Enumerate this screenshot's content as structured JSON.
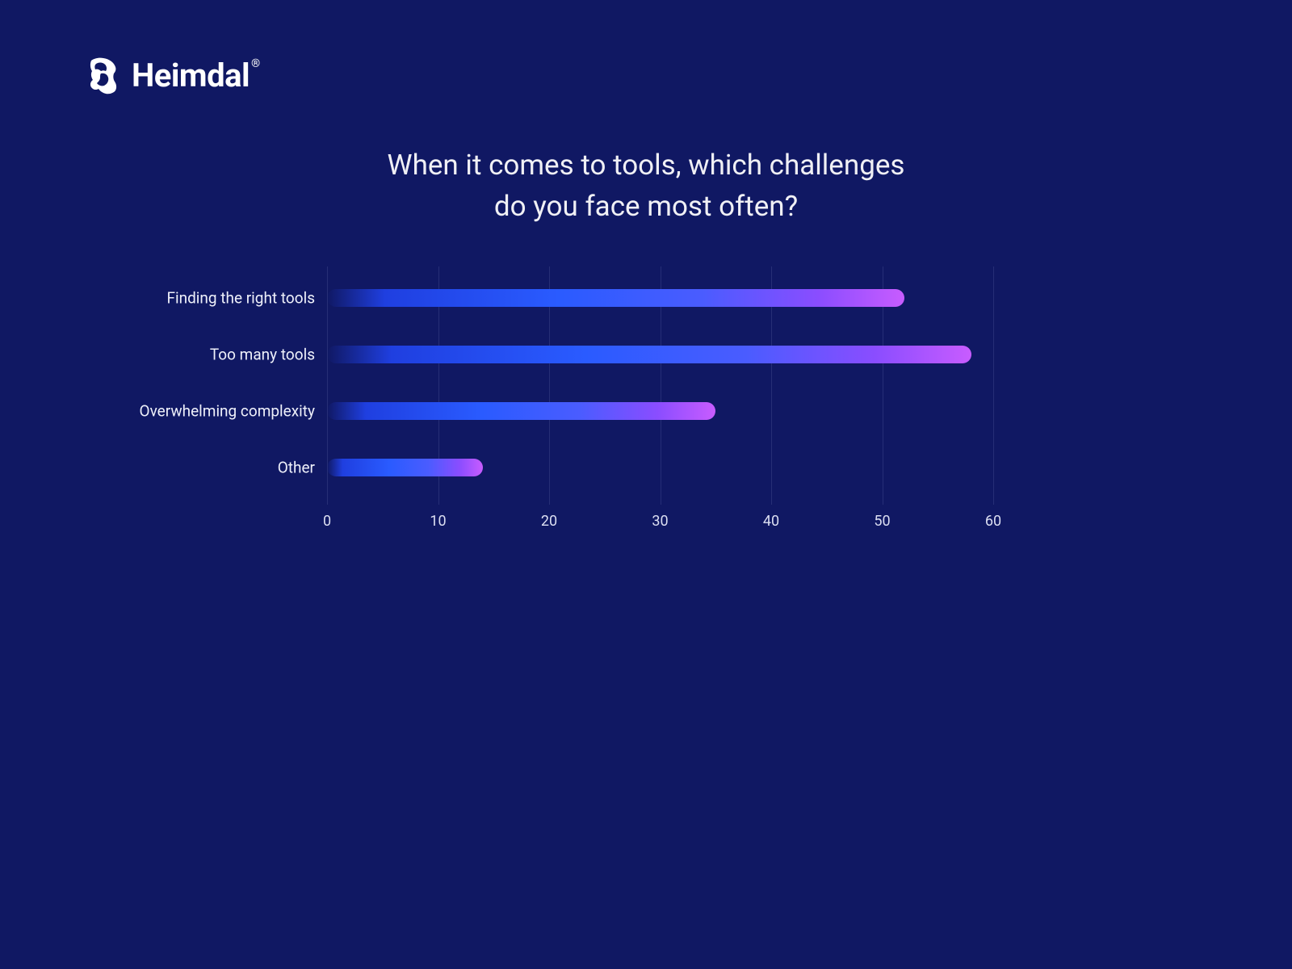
{
  "brand": {
    "name": "Heimdal",
    "registered_mark": "®"
  },
  "chart_data": {
    "type": "bar",
    "orientation": "horizontal",
    "title": "When it comes to tools, which challenges\ndo you face most often?",
    "categories": [
      "Finding the right tools",
      "Too many tools",
      "Overwhelming complexity",
      "Other"
    ],
    "values": [
      52,
      58,
      35,
      14
    ],
    "xlabel": "",
    "ylabel": "",
    "xlim": [
      0,
      60
    ],
    "xticks": [
      0,
      10,
      20,
      30,
      40,
      50,
      60
    ],
    "grid": true,
    "colors": {
      "background": "#101863",
      "gradient_start": "#1f3fe0",
      "gradient_end": "#c85cff"
    }
  }
}
